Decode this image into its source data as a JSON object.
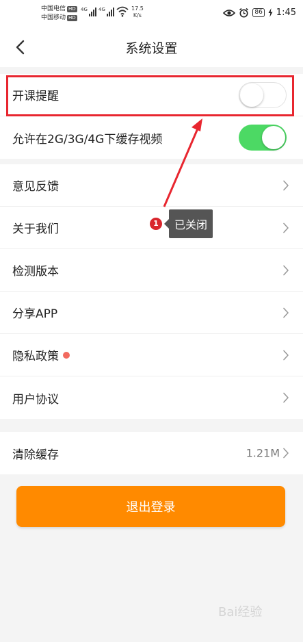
{
  "status_bar": {
    "carrier1": "中国电信",
    "carrier2": "中国移动",
    "hd": "HD",
    "net1": "4G",
    "net2": "4G",
    "speed_value": "17.5",
    "speed_unit": "K/s",
    "battery": "86",
    "time": "1:45"
  },
  "header": {
    "title": "系统设置"
  },
  "settings_group1": [
    {
      "label": "开课提醒",
      "toggle": "off"
    },
    {
      "label": "允许在2G/3G/4G下缓存视频",
      "toggle": "on"
    }
  ],
  "settings_group2": [
    {
      "label": "意见反馈"
    },
    {
      "label": "关于我们"
    },
    {
      "label": "检测版本"
    },
    {
      "label": "分享APP"
    },
    {
      "label": "隐私政策"
    },
    {
      "label": "用户协议"
    }
  ],
  "cache": {
    "label": "清除缓存",
    "value": "1.21M"
  },
  "logout_label": "退出登录",
  "annotation": {
    "number": "1",
    "text": "已关闭"
  },
  "colors": {
    "accent": "#ff8a00",
    "toggle_on": "#4cd964",
    "annotation_red": "#e8262f",
    "privacy_dot": "#f26a5f"
  },
  "watermark": "Bai经验"
}
